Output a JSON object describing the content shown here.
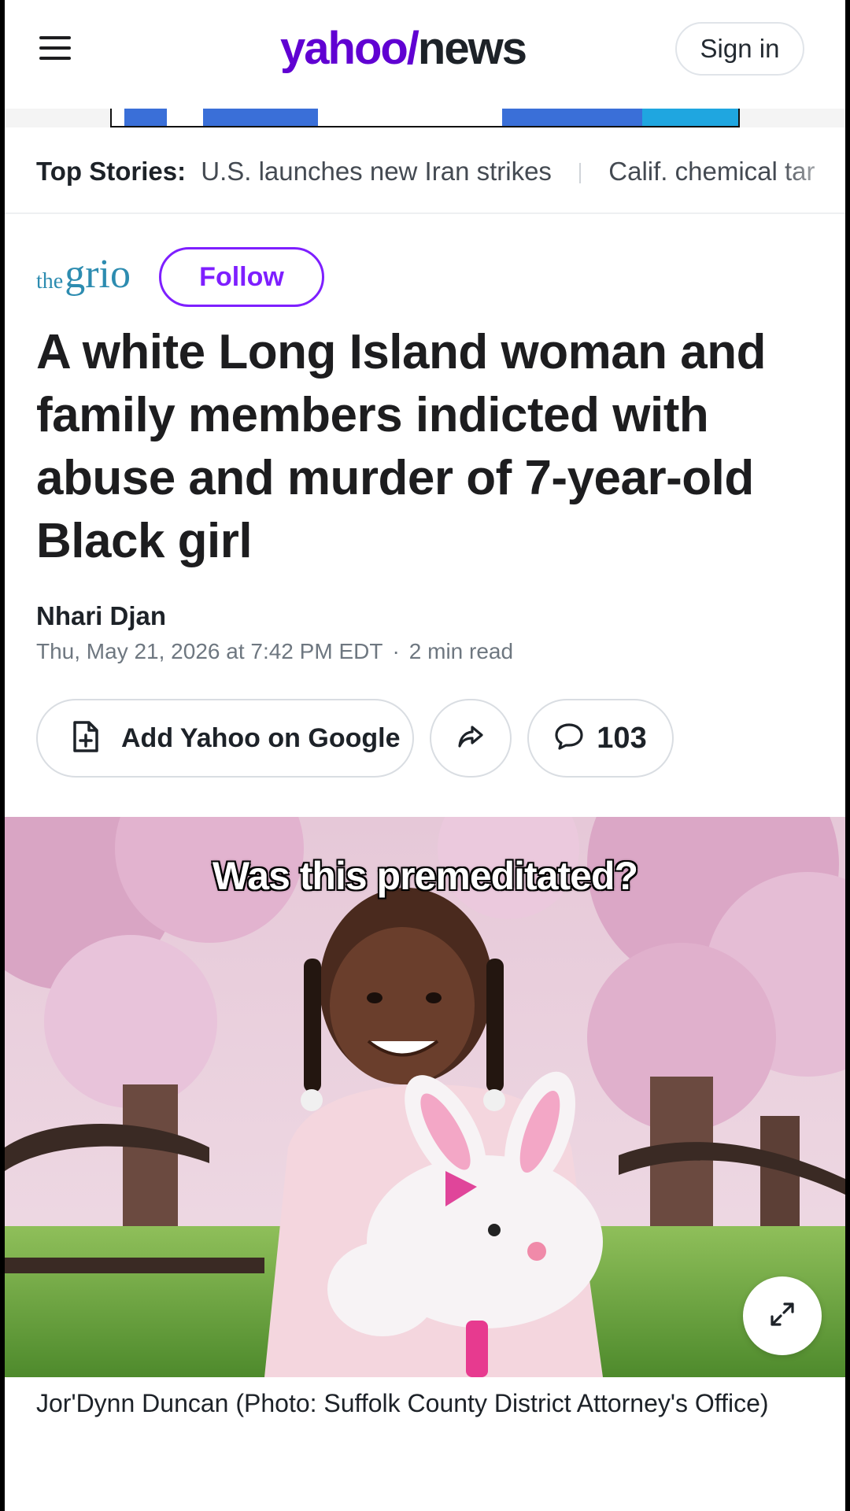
{
  "header": {
    "logo_yahoo": "yahoo/",
    "logo_news": "news",
    "signin_label": "Sign in",
    "brand_color": "#6001d2"
  },
  "top_stories": {
    "label": "Top Stories:",
    "items": [
      "U.S. launches new Iran strikes",
      "Calif. chemical tar"
    ]
  },
  "article": {
    "source_the": "the",
    "source_grio": "grio",
    "follow_label": "Follow",
    "headline": "A white Long Island woman and family members indicted with abuse and murder of 7-year-old Black girl",
    "author": "Nhari Djan",
    "date": "Thu, May 21, 2026 at 7:42 PM EDT",
    "read_time": "2 min read",
    "meta_separator": "·"
  },
  "actions": {
    "add_google_label": "Add Yahoo on Google",
    "comment_count": "103",
    "icons": [
      "add-document-icon",
      "share-arrow-icon",
      "comment-bubble-icon",
      "expand-icon"
    ]
  },
  "media": {
    "overlay_caption": "Was this premeditated?",
    "photo_caption": "Jor'Dynn Duncan (Photo: Suffolk County District Attorney's Office)"
  },
  "colors": {
    "follow_accent": "#7e1fff",
    "source_logo": "#2d8cb0"
  }
}
